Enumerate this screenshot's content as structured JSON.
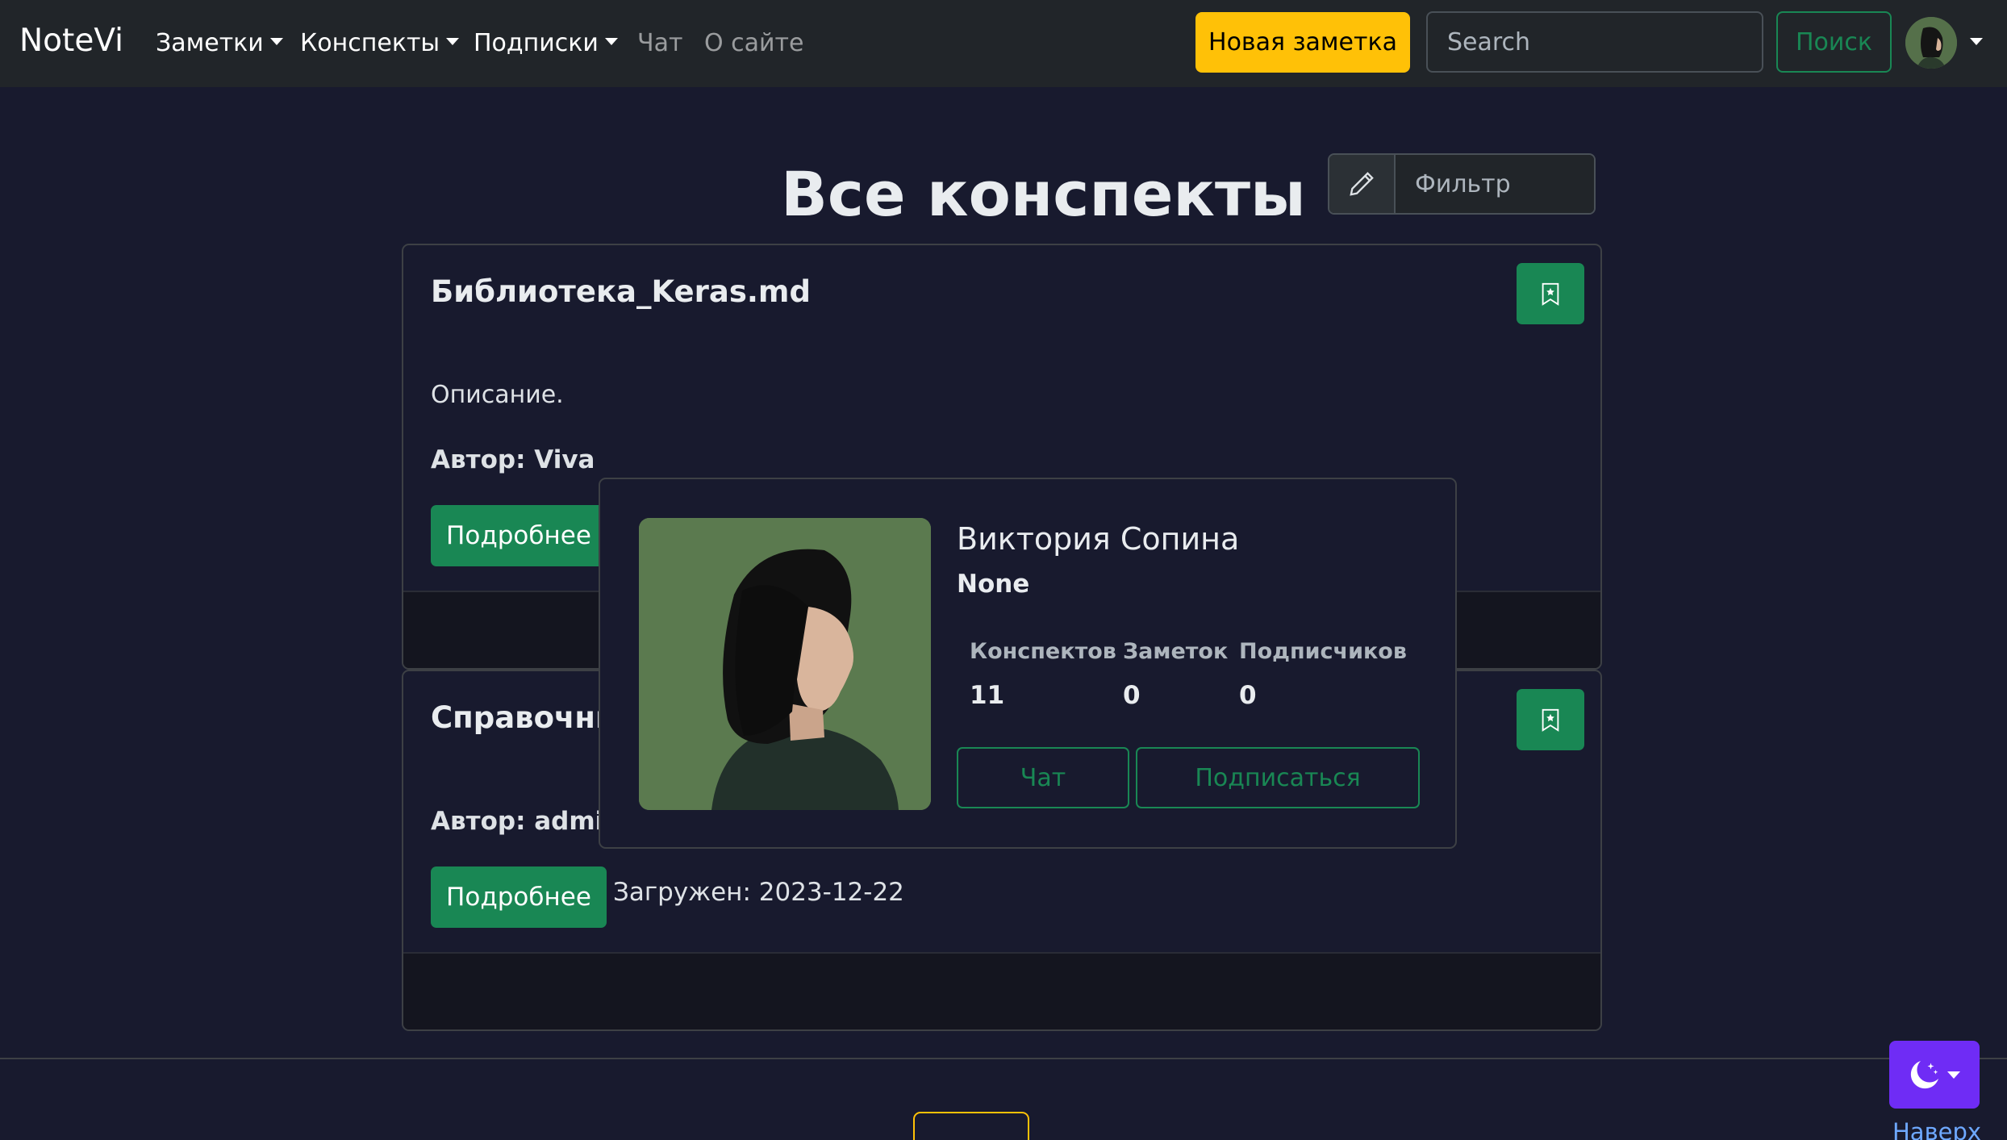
{
  "navbar": {
    "brand": "NoteVi",
    "items": [
      {
        "label": "Заметки",
        "dropdown": true
      },
      {
        "label": "Конспекты",
        "dropdown": true
      },
      {
        "label": "Подписки",
        "dropdown": true
      },
      {
        "label": "Чат",
        "dropdown": false
      },
      {
        "label": "О сайте",
        "dropdown": false
      }
    ],
    "new_note_label": "Новая заметка",
    "search_placeholder": "Search",
    "search_button_label": "Поиск"
  },
  "page": {
    "title": "Все конспекты",
    "filter_label": "Фильтр"
  },
  "cards": [
    {
      "title": "Библиотека_Keras.md",
      "description": "Описание.",
      "author": "Автор: Viva",
      "details_label": "Подробнее"
    },
    {
      "title": "Справочни",
      "author": "Автор: admin",
      "details_label": "Подробнее",
      "uploaded": "Загружен: 2023-12-22"
    }
  ],
  "popover": {
    "name": "Виктория Сопина",
    "status": "None",
    "stats": [
      {
        "label": "Конспектов",
        "value": "11"
      },
      {
        "label": "Заметок",
        "value": "0"
      },
      {
        "label": "Подписчиков",
        "value": "0"
      }
    ],
    "chat_label": "Чат",
    "subscribe_label": "Подписаться"
  },
  "bottom": {
    "to_top_label": "Наверх"
  },
  "colors": {
    "background": "#181a2e",
    "navbar": "#212529",
    "accent_yellow": "#ffc107",
    "accent_green": "#198754",
    "theme_purple": "#6f2cf5",
    "link_blue": "#6ea8fe"
  },
  "icons": {
    "filter": "pencil-icon",
    "bookmark": "bookmark-star-icon",
    "theme": "moon-stars-icon"
  }
}
